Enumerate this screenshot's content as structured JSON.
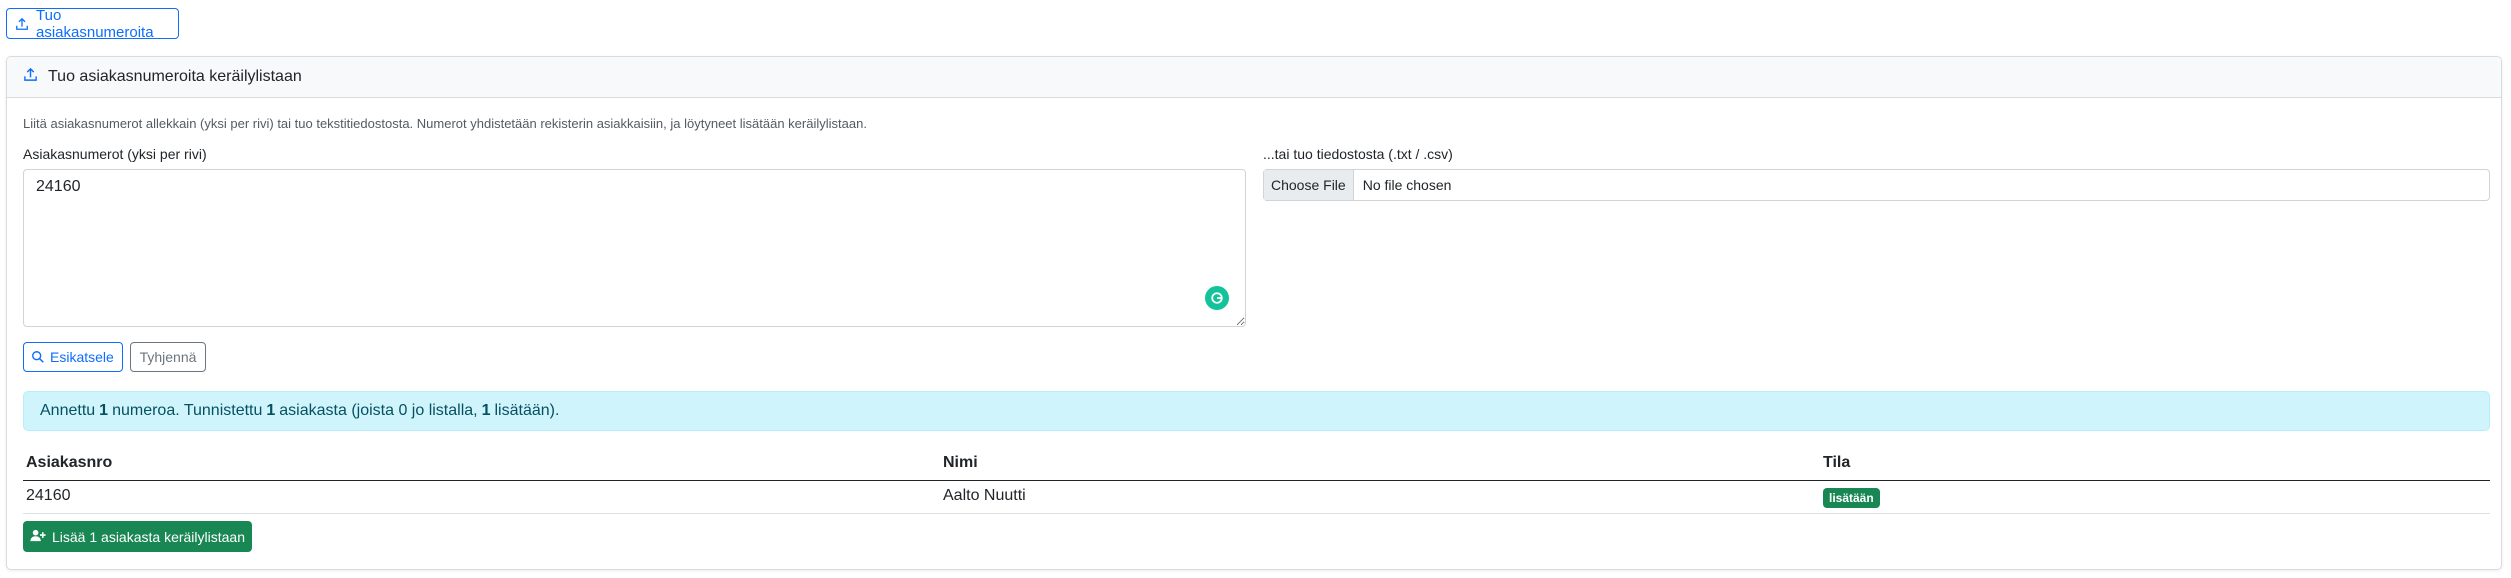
{
  "toolbar": {
    "import_button_label": "Tuo asiakasnumeroita"
  },
  "card": {
    "title": "Tuo asiakasnumeroita keräilylistaan",
    "help_text": "Liitä asiakasnumerot allekkain (yksi per rivi) tai tuo tekstitiedostosta. Numerot yhdistetään rekisterin asiakkaisiin, ja löytyneet lisätään keräilylistaan.",
    "numbers_label": "Asiakasnumerot (yksi per rivi)",
    "numbers_value": "24160",
    "file_label": "...tai tuo tiedostosta (.txt / .csv)",
    "file_button_label": "Choose File",
    "file_status": "No file chosen",
    "preview_button_label": "Esikatsele",
    "clear_button_label": "Tyhjennä"
  },
  "summary": {
    "text_1": "Annettu",
    "given_count": "1",
    "text_2": "numeroa. Tunnistettu",
    "recognized_count": "1",
    "text_3": "asiakasta (joista 0 jo listalla,",
    "to_add_count": "1",
    "text_4": "lisätään)."
  },
  "table": {
    "columns": [
      "Asiakasnro",
      "Nimi",
      "Tila"
    ],
    "rows": [
      {
        "customer_number": "24160",
        "name": "Aalto Nuutti",
        "status": "lisätään"
      }
    ]
  },
  "add_button_label": "Lisää 1 asiakasta keräilylistaan",
  "colors": {
    "primary": "#0d6efd",
    "success": "#198754",
    "info_bg": "#cff4fc",
    "info_text": "#055160",
    "secondary": "#6c757d"
  },
  "icons": {
    "import": "upload-icon",
    "preview": "search-icon",
    "add": "user-plus-icon",
    "grammarly": "grammarly-icon"
  }
}
